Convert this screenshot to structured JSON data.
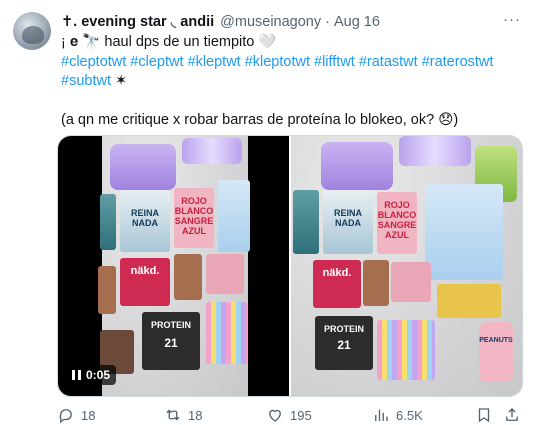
{
  "post": {
    "display_name": "✝. evening star ◟ andii",
    "handle": "@museinagony",
    "separator": "·",
    "date": "Aug 16",
    "more_icon": "ellipsis-icon",
    "line1": "¡ 𝐞 🔭 haul dps de un tiempito 🤍",
    "hashtags_line1": [
      "#cleptotwt",
      "#cleptwt",
      "#kleptwt",
      "#kleptotwt",
      "#lifftwt",
      "#ratastwt",
      "#raterostwt"
    ],
    "hashtags_line2": [
      "#subtwt"
    ],
    "line2_suffix": "✶",
    "quote": "(a qn me critique x robar barras de proteína lo blokeo, ok? 😞)"
  },
  "media": {
    "video_time": "0:05",
    "product_labels": {
      "book_reina": "REINA NADA",
      "book_rojo": "ROJO BLANCO SANGRE AZUL",
      "nakd": "näkd.",
      "protein": "PROTEIN",
      "protein_count": "21",
      "peanuts": "PEANUTS"
    }
  },
  "actions": {
    "replies": "18",
    "reposts": "18",
    "likes": "195",
    "views": "6.5K"
  },
  "colors": {
    "hashtag": "#1d9bf0",
    "text": "#0f1419",
    "secondary": "#536471"
  }
}
